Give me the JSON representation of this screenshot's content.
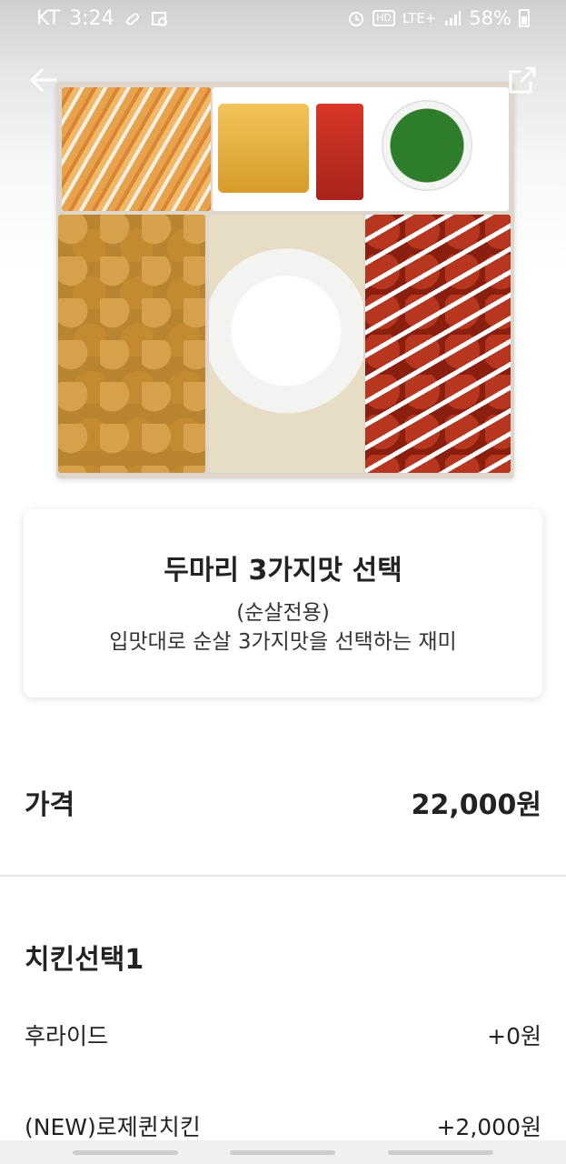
{
  "status_bar": {
    "carrier": "KT",
    "time": "3:24",
    "hd_label": "HD",
    "network": "LTE+",
    "battery": "58%"
  },
  "hero": {
    "back_icon": "back-arrow-icon",
    "share_icon": "share-external-icon"
  },
  "menu": {
    "title": "두마리 3가지맛 선택",
    "desc_line1": "(순살전용)",
    "desc_line2": "입맛대로 순살 3가지맛을 선택하는 재미"
  },
  "price": {
    "label": "가격",
    "value": "22,000원"
  },
  "options": {
    "group_title": "치킨선택1",
    "items": [
      {
        "name": "후라이드",
        "price": "+0원"
      },
      {
        "name": "(NEW)로제퀸치킨",
        "price": "+2,000원"
      }
    ]
  },
  "colors": {
    "status_text": "#ffffff",
    "text_primary": "#222222",
    "divider": "#e6e6e6",
    "nav_handle": "#cdcdcd"
  }
}
